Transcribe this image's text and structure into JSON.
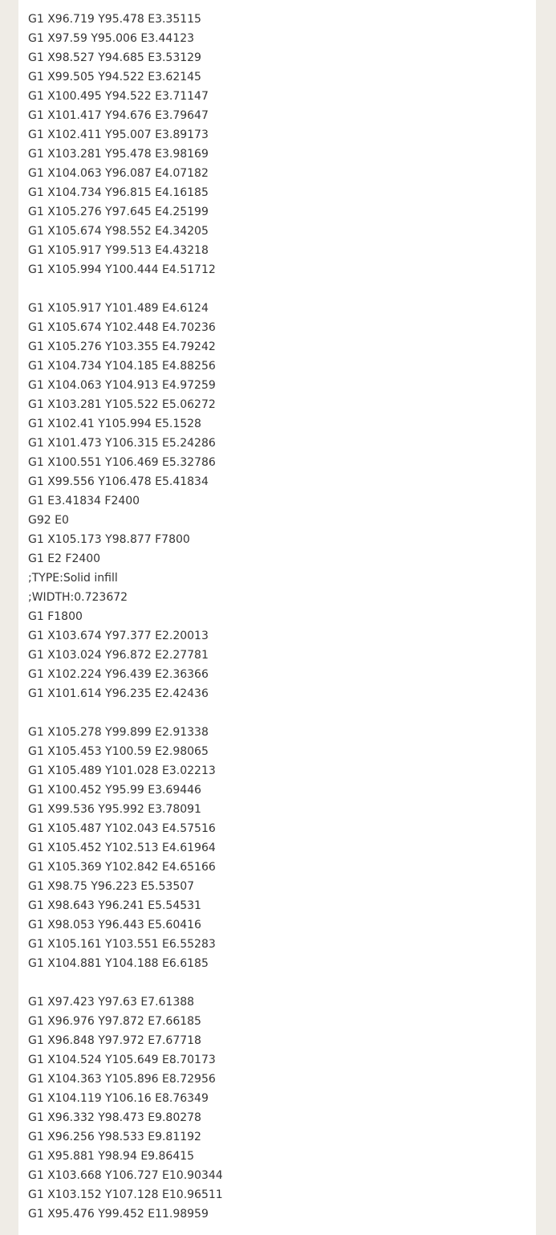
{
  "blocks": [
    [
      "G1 X96.719 Y95.478 E3.35115",
      "G1 X97.59 Y95.006 E3.44123",
      "G1 X98.527 Y94.685 E3.53129",
      "G1 X99.505 Y94.522 E3.62145",
      "G1 X100.495 Y94.522 E3.71147",
      "G1 X101.417 Y94.676 E3.79647",
      "G1 X102.411 Y95.007 E3.89173",
      "G1 X103.281 Y95.478 E3.98169",
      "G1 X104.063 Y96.087 E4.07182",
      "G1 X104.734 Y96.815 E4.16185",
      "G1 X105.276 Y97.645 E4.25199",
      "G1 X105.674 Y98.552 E4.34205",
      "G1 X105.917 Y99.513 E4.43218",
      "G1 X105.994 Y100.444 E4.51712"
    ],
    [
      "G1 X105.917 Y101.489 E4.6124",
      "G1 X105.674 Y102.448 E4.70236",
      "G1 X105.276 Y103.355 E4.79242",
      "G1 X104.734 Y104.185 E4.88256",
      "G1 X104.063 Y104.913 E4.97259",
      "G1 X103.281 Y105.522 E5.06272",
      "G1 X102.41 Y105.994 E5.1528",
      "G1 X101.473 Y106.315 E5.24286",
      "G1 X100.551 Y106.469 E5.32786",
      "G1 X99.556 Y106.478 E5.41834",
      "G1 E3.41834 F2400",
      "G92 E0",
      "G1 X105.173 Y98.877 F7800",
      "G1 E2 F2400",
      ";TYPE:Solid infill",
      ";WIDTH:0.723672",
      "G1 F1800",
      "G1 X103.674 Y97.377 E2.20013",
      "G1 X103.024 Y96.872 E2.27781",
      "G1 X102.224 Y96.439 E2.36366",
      "G1 X101.614 Y96.235 E2.42436"
    ],
    [
      "G1 X105.278 Y99.899 E2.91338",
      "G1 X105.453 Y100.59 E2.98065",
      "G1 X105.489 Y101.028 E3.02213",
      "G1 X100.452 Y95.99 E3.69446",
      "G1 X99.536 Y95.992 E3.78091",
      "G1 X105.487 Y102.043 E4.57516",
      "G1 X105.452 Y102.513 E4.61964",
      "G1 X105.369 Y102.842 E4.65166",
      "G1 X98.75 Y96.223 E5.53507",
      "G1 X98.643 Y96.241 E5.54531",
      "G1 X98.053 Y96.443 E5.60416",
      "G1 X105.161 Y103.551 E6.55283",
      "G1 X104.881 Y104.188 E6.6185"
    ],
    [
      "G1 X97.423 Y97.63 E7.61388",
      "G1 X96.976 Y97.872 E7.66185",
      "G1 X96.848 Y97.972 E7.67718",
      "G1 X104.524 Y105.649 E8.70173",
      "G1 X104.363 Y105.896 E8.72956",
      "G1 X104.119 Y106.16 E8.76349",
      "G1 X96.332 Y98.473 E9.80278",
      "G1 X96.256 Y98.533 E9.81192",
      "G1 X95.881 Y98.94 E9.86415",
      "G1 X103.668 Y106.727 E10.90344",
      "G1 X103.152 Y107.128 E10.96511",
      "G1 X95.476 Y99.452 E11.98959"
    ]
  ]
}
